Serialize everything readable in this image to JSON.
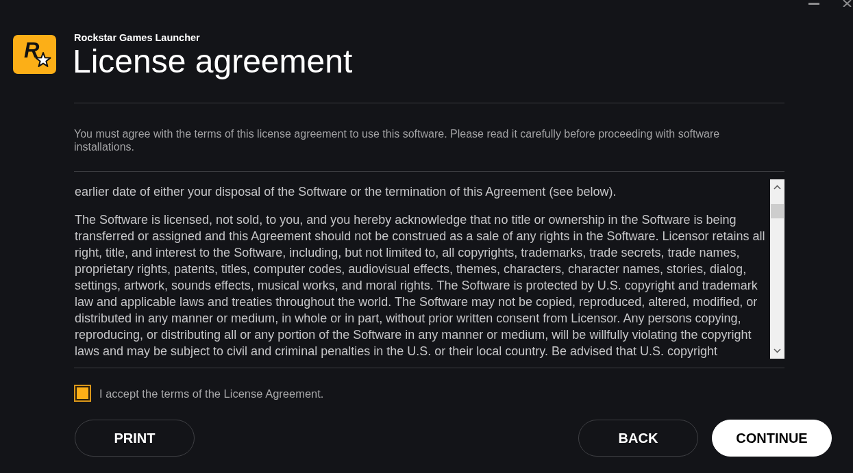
{
  "header": {
    "logo_letter": "R",
    "app_name": "Rockstar Games Launcher",
    "title": "License agreement"
  },
  "intro": "You must agree with the terms of this license agreement to use this software. Please read it carefully before proceeding with software installations.",
  "license": {
    "paragraphs": [
      "earlier date of either your disposal of the Software or the termination of this Agreement (see below).",
      "The Software is licensed, not sold, to you, and you hereby acknowledge that no title or ownership in the Software is being transferred or assigned and this Agreement should not be construed as a sale of any rights in the Software. Licensor retains all right, title, and interest to the Software, including, but not limited to, all copyrights, trademarks, trade secrets, trade names, proprietary rights, patents, titles, computer codes, audiovisual effects, themes, characters, character names, stories, dialog, settings, artwork, sounds effects, musical works, and moral rights. The Software is protected by U.S. copyright and trademark law and applicable laws and treaties throughout the world. The Software may not be copied, reproduced, altered, modified, or distributed in any manner or medium, in whole or in part, without prior written consent from Licensor. Any persons copying, reproducing, or distributing all or any portion of the Software in any manner or medium, will be willfully violating the copyright laws and may be subject to civil and criminal penalties in the U.S. or their local country. Be advised that U.S. copyright"
    ]
  },
  "accept": {
    "label": "I accept the terms of the License Agreement.",
    "checked": true
  },
  "buttons_left": [
    {
      "label": "PRINT",
      "kind": "secondary"
    }
  ],
  "buttons_right": [
    {
      "label": "BACK",
      "kind": "secondary"
    },
    {
      "label": "CONTINUE",
      "kind": "primary"
    }
  ]
}
